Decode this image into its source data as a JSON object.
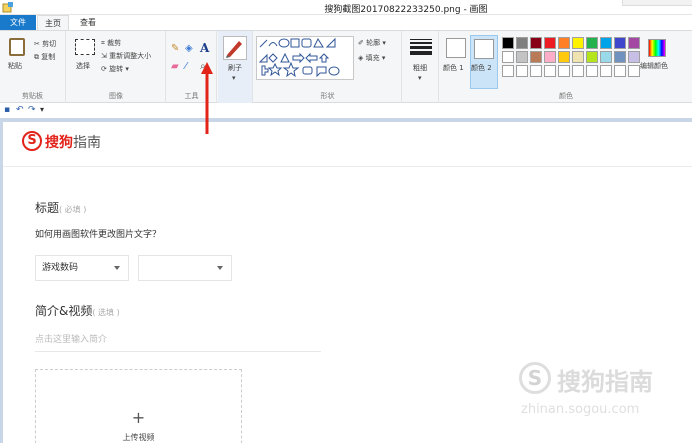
{
  "window": {
    "title": "搜狗截图20170822233250.png - 画图"
  },
  "menu": {
    "file": "文件",
    "home": "主页",
    "view": "查看"
  },
  "ribbon": {
    "clipboard": {
      "paste": "粘贴",
      "cut": "剪切",
      "copy": "复制",
      "label": "剪贴板"
    },
    "image": {
      "select": "选择",
      "crop": "裁剪",
      "resize": "重新调整大小",
      "rotate": "旋转",
      "label": "图像"
    },
    "tools": {
      "text_tool": "A",
      "label": "工具"
    },
    "brushes": {
      "label": "刷子"
    },
    "shapes": {
      "outline": "轮廓",
      "fill": "填充",
      "label": "形状"
    },
    "size": {
      "label": "粗细"
    },
    "colors": {
      "color1": "颜色 1",
      "color2": "颜色 2",
      "edit": "编辑颜色",
      "label": "颜色",
      "palette_row1": [
        "#000000",
        "#7f7f7f",
        "#880015",
        "#ed1c24",
        "#ff7f27",
        "#fff200",
        "#22b14c",
        "#00a2e8",
        "#3f48cc",
        "#a349a4"
      ],
      "palette_row2": [
        "#ffffff",
        "#c3c3c3",
        "#b97a57",
        "#ffaec9",
        "#ffc90e",
        "#efe4b0",
        "#b5e61d",
        "#99d9ea",
        "#7092be",
        "#c8bfe7"
      ]
    }
  },
  "page": {
    "logo": {
      "s": "S",
      "brand": "搜狗",
      "suffix": "指南"
    },
    "title_field": {
      "label": "标题",
      "hint": "( 必填 )",
      "question": "如何用画图软件更改图片文字？"
    },
    "category": {
      "selected": "游戏数码"
    },
    "intro": {
      "label": "简介&视频",
      "hint": "( 选填 )",
      "placeholder": "点击这里输入简介"
    },
    "upload": {
      "plus": "+",
      "label": "上传视频"
    },
    "watermark": {
      "s": "S",
      "cn": "搜狗指南",
      "url": "zhinan.sogou.com"
    }
  },
  "colors": {
    "accent": "#1979ca",
    "arrow": "#e2231a",
    "canvas_bg": "#c9d6e8"
  }
}
